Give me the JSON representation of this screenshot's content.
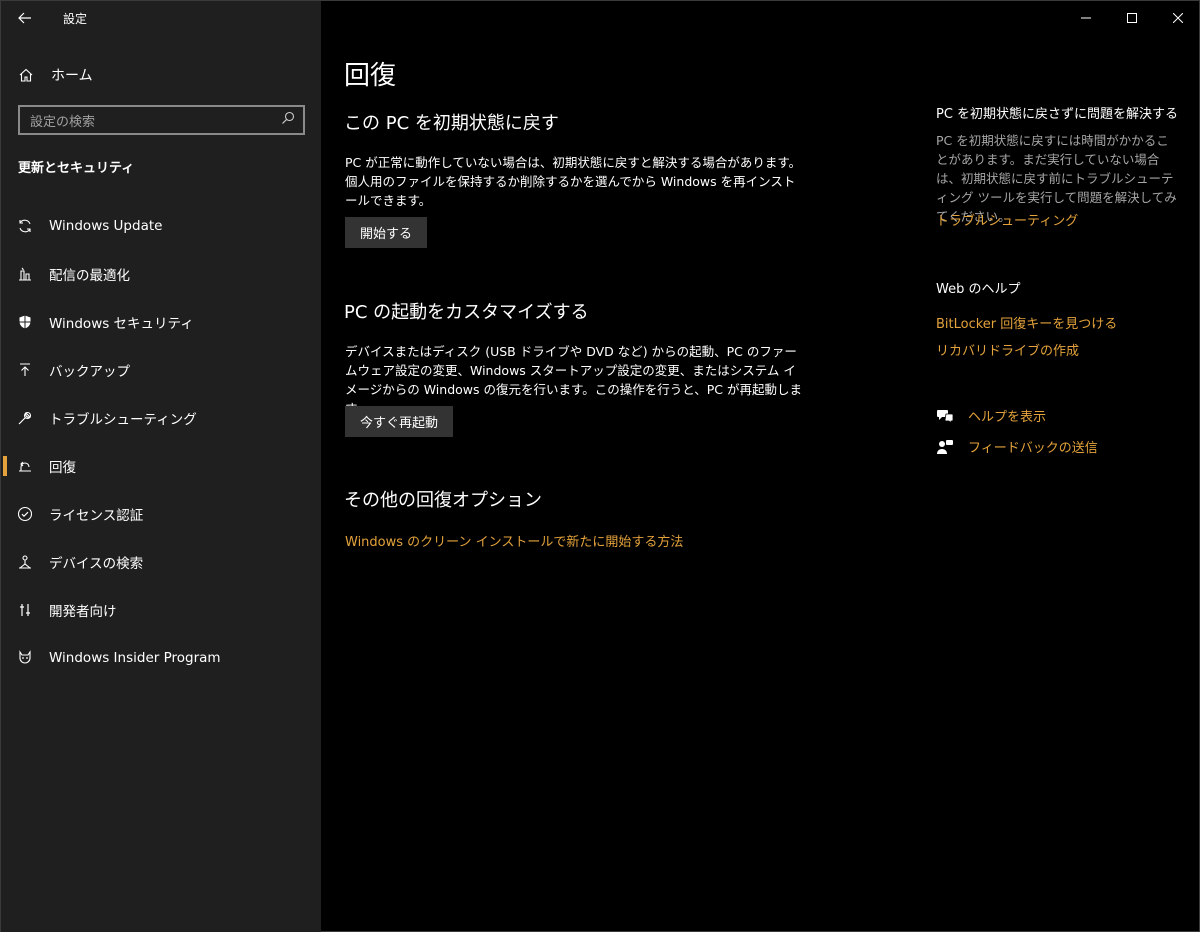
{
  "window": {
    "title": "設定",
    "controls": {
      "minimize": "—",
      "maximize": "☐",
      "close": "✕"
    },
    "back": "←"
  },
  "sidebar": {
    "home_label": "ホーム",
    "search_placeholder": "設定の検索",
    "section_heading": "更新とセキュリティ",
    "items": [
      {
        "label": "Windows Update",
        "icon": "sync-icon"
      },
      {
        "label": "配信の最適化",
        "icon": "delivery-optimization-icon"
      },
      {
        "label": "Windows セキュリティ",
        "icon": "shield-icon"
      },
      {
        "label": "バックアップ",
        "icon": "backup-icon"
      },
      {
        "label": "トラブルシューティング",
        "icon": "wrench-icon"
      },
      {
        "label": "回復",
        "icon": "recovery-icon",
        "selected": true
      },
      {
        "label": "ライセンス認証",
        "icon": "check-circle-icon"
      },
      {
        "label": "デバイスの検索",
        "icon": "find-device-icon"
      },
      {
        "label": "開発者向け",
        "icon": "developer-icon"
      },
      {
        "label": "Windows Insider Program",
        "icon": "insider-cat-icon"
      }
    ]
  },
  "main": {
    "page_title": "回復",
    "reset": {
      "heading": "この PC を初期状態に戻す",
      "description": "PC が正常に動作していない場合は、初期状態に戻すと解決する場合があります。個人用のファイルを保持するか削除するかを選んでから Windows を再インストールできます。",
      "button": "開始する"
    },
    "advanced_startup": {
      "heading": "PC の起動をカスタマイズする",
      "description": "デバイスまたはディスク (USB ドライブや DVD など) からの起動、PC のファームウェア設定の変更、Windows スタートアップ設定の変更、またはシステム イメージからの Windows の復元を行います。この操作を行うと、PC が再起動します。",
      "button": "今すぐ再起動"
    },
    "more_options": {
      "heading": "その他の回復オプション",
      "link": "Windows のクリーン インストールで新たに開始する方法"
    }
  },
  "right": {
    "fix_heading": "PC を初期状態に戻さずに問題を解決する",
    "fix_description": "PC を初期状態に戻すには時間がかかることがあります。まだ実行していない場合は、初期状態に戻す前にトラブルシューティング ツールを実行して問題を解決してみてください。",
    "fix_link": "トラブルシューティング",
    "web_help_heading": "Web のヘルプ",
    "web_links": [
      "BitLocker 回復キーを見つける",
      "リカバリドライブの作成"
    ],
    "help_label": "ヘルプを表示",
    "feedback_label": "フィードバックの送信"
  },
  "colors": {
    "accent": "#e3a23b",
    "sidebar_bg": "#1f1f1f",
    "main_bg": "#000000",
    "button_bg": "#333333"
  }
}
